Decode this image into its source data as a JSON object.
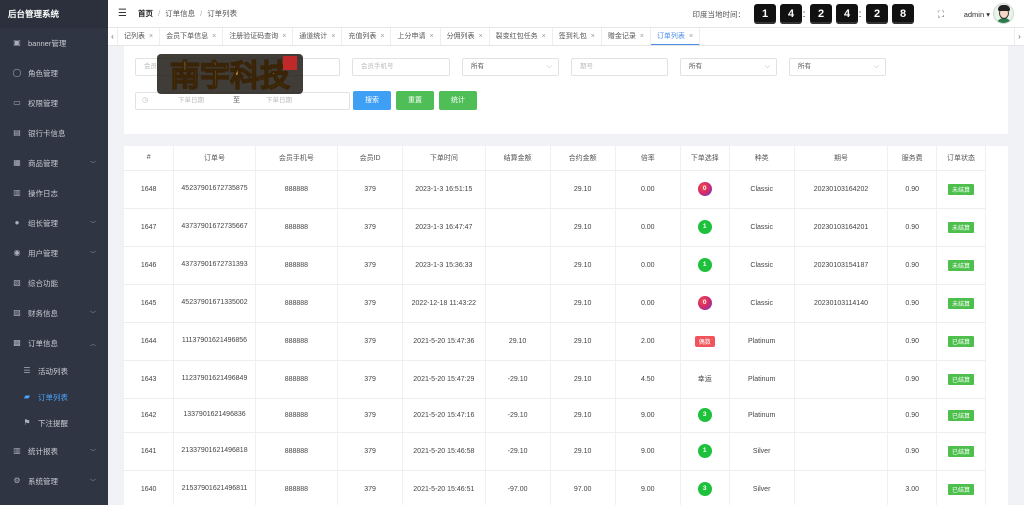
{
  "app": {
    "title": "后台管理系统"
  },
  "sidebar": {
    "items": [
      {
        "label": "banner管理",
        "icon": "image-icon",
        "has_arrow": false
      },
      {
        "label": "角色管理",
        "icon": "user-icon",
        "has_arrow": false
      },
      {
        "label": "权限管理",
        "icon": "monitor-icon",
        "has_arrow": false
      },
      {
        "label": "银行卡信息",
        "icon": "card-icon",
        "has_arrow": false
      },
      {
        "label": "商品管理",
        "icon": "box-icon",
        "has_arrow": true
      },
      {
        "label": "操作日志",
        "icon": "log-icon",
        "has_arrow": false
      },
      {
        "label": "组长管理",
        "icon": "group-icon",
        "has_arrow": true
      },
      {
        "label": "用户管理",
        "icon": "users-icon",
        "has_arrow": true
      },
      {
        "label": "综合功能",
        "icon": "grid-icon",
        "has_arrow": false
      },
      {
        "label": "财务信息",
        "icon": "wallet-icon",
        "has_arrow": true
      },
      {
        "label": "订单信息",
        "icon": "order-icon",
        "has_arrow": true,
        "expanded": true
      }
    ],
    "subitems": [
      {
        "label": "活动列表",
        "icon": "list-icon",
        "active": false
      },
      {
        "label": "订单列表",
        "icon": "database-icon",
        "active": true
      },
      {
        "label": "下注提醒",
        "icon": "flag-icon",
        "active": false
      }
    ],
    "bottom_items": [
      {
        "label": "统计报表",
        "icon": "chart-icon",
        "has_arrow": true
      },
      {
        "label": "系统管理",
        "icon": "gear-icon",
        "has_arrow": true
      }
    ]
  },
  "header": {
    "breadcrumb": [
      "首页",
      "订单信息",
      "订单列表"
    ],
    "clock_label": "印度当地时间：",
    "clock_digits": [
      "1",
      "4",
      "2",
      "4",
      "2",
      "8"
    ],
    "user": "admin"
  },
  "tabs": [
    {
      "label": "记列表",
      "active": false
    },
    {
      "label": "会员下单信息",
      "active": false
    },
    {
      "label": "注册验证码查询",
      "active": false
    },
    {
      "label": "通道统计",
      "active": false
    },
    {
      "label": "充值列表",
      "active": false
    },
    {
      "label": "上分申请",
      "active": false
    },
    {
      "label": "分佣列表",
      "active": false
    },
    {
      "label": "裂变红包任务",
      "active": false
    },
    {
      "label": "签到礼包",
      "active": false
    },
    {
      "label": "赠金记录",
      "active": false
    },
    {
      "label": "订单列表",
      "active": true
    }
  ],
  "filters": {
    "member_placeholder": "会员",
    "phone_placeholder": "会员手机号",
    "select1": "所有",
    "period_placeholder": "期号",
    "select2": "所有",
    "select3": "所有",
    "date_from_placeholder": "下单日期",
    "date_sep": "至",
    "date_to_placeholder": "下单日期",
    "search_label": "搜索",
    "reset_label": "重置",
    "stats_label": "统计"
  },
  "watermark": {
    "text": "南宇科技"
  },
  "table": {
    "columns": [
      "#",
      "订单号",
      "会员手机号",
      "会员ID",
      "下单时间",
      "结算金额",
      "合约金额",
      "倍率",
      "下单选择",
      "种类",
      "期号",
      "服务费",
      "订单状态"
    ],
    "rows": [
      {
        "id": "1648",
        "order": "45237901672735875",
        "phone": "888888",
        "uid": "379",
        "time": "2023-1-3 16:51:15",
        "settle": "",
        "amount": "29.10",
        "rate": "0.00",
        "choice": "0",
        "choice_type": "zero",
        "kind": "Classic",
        "period": "20230103164202",
        "fee": "0.90",
        "status": "未结算"
      },
      {
        "id": "1647",
        "order": "43737901672735667",
        "phone": "888888",
        "uid": "379",
        "time": "2023-1-3 16:47:47",
        "settle": "",
        "amount": "29.10",
        "rate": "0.00",
        "choice": "1",
        "choice_type": "green",
        "kind": "Classic",
        "period": "20230103164201",
        "fee": "0.90",
        "status": "未结算"
      },
      {
        "id": "1646",
        "order": "43737901672731393",
        "phone": "888888",
        "uid": "379",
        "time": "2023-1-3 15:36:33",
        "settle": "",
        "amount": "29.10",
        "rate": "0.00",
        "choice": "1",
        "choice_type": "green",
        "kind": "Classic",
        "period": "20230103154187",
        "fee": "0.90",
        "status": "未结算"
      },
      {
        "id": "1645",
        "order": "45237901671335002",
        "phone": "888888",
        "uid": "379",
        "time": "2022-12-18 11:43:22",
        "settle": "",
        "amount": "29.10",
        "rate": "0.00",
        "choice": "0",
        "choice_type": "zero",
        "kind": "Classic",
        "period": "20230103114140",
        "fee": "0.90",
        "status": "未结算"
      },
      {
        "id": "1644",
        "order": "11137901621496856",
        "phone": "888888",
        "uid": "379",
        "time": "2021-5-20 15:47:36",
        "settle": "29.10",
        "amount": "29.10",
        "rate": "2.00",
        "choice": "偶数",
        "choice_type": "tag",
        "kind": "Platinum",
        "period": "",
        "fee": "0.90",
        "status": "已结算"
      },
      {
        "id": "1643",
        "order": "11237901621496849",
        "phone": "888888",
        "uid": "379",
        "time": "2021-5-20 15:47:29",
        "settle": "-29.10",
        "amount": "29.10",
        "rate": "4.50",
        "choice": "幸运",
        "choice_type": "text",
        "kind": "Platinum",
        "period": "",
        "fee": "0.90",
        "status": "已结算"
      },
      {
        "id": "1642",
        "order": "1337901621496836",
        "phone": "888888",
        "uid": "379",
        "time": "2021-5-20 15:47:16",
        "settle": "-29.10",
        "amount": "29.10",
        "rate": "9.00",
        "choice": "3",
        "choice_type": "green",
        "kind": "Platinum",
        "period": "",
        "fee": "0.90",
        "status": "已结算",
        "short": true
      },
      {
        "id": "1641",
        "order": "21337901621496818",
        "phone": "888888",
        "uid": "379",
        "time": "2021-5-20 15:46:58",
        "settle": "-29.10",
        "amount": "29.10",
        "rate": "9.00",
        "choice": "1",
        "choice_type": "green",
        "kind": "Silver",
        "period": "",
        "fee": "0.90",
        "status": "已结算"
      },
      {
        "id": "1640",
        "order": "21537901621496811",
        "phone": "888888",
        "uid": "379",
        "time": "2021-5-20 15:46:51",
        "settle": "-97.00",
        "amount": "97.00",
        "rate": "9.00",
        "choice": "3",
        "choice_type": "green",
        "kind": "Silver",
        "period": "",
        "fee": "3.00",
        "status": "已结算"
      }
    ]
  }
}
